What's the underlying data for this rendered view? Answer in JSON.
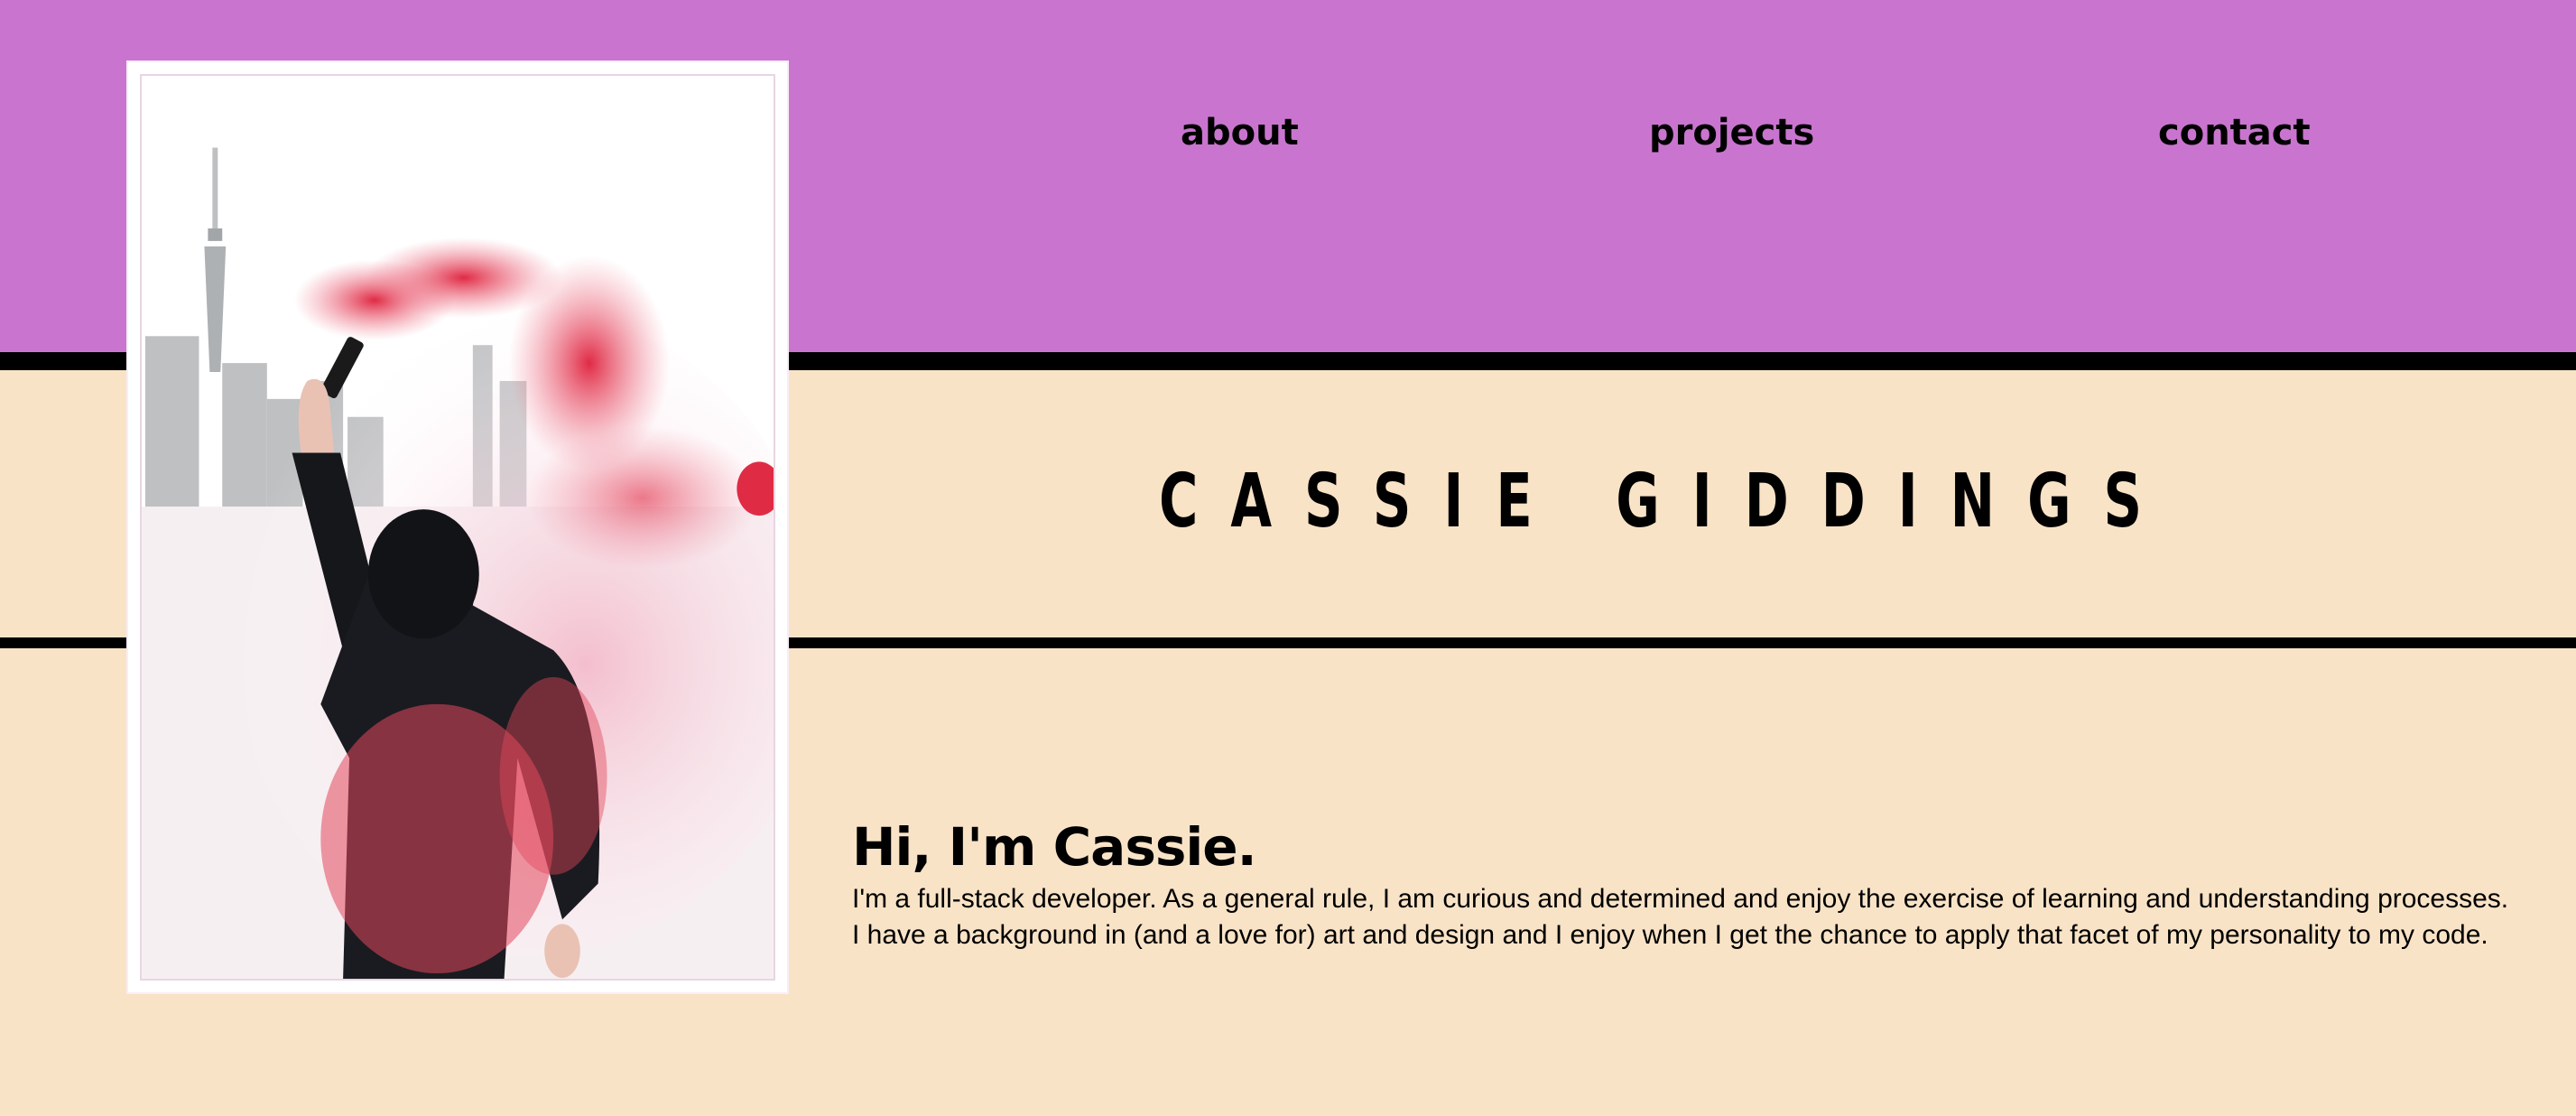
{
  "nav": {
    "about": "about",
    "projects": "projects",
    "contact": "contact"
  },
  "header": {
    "title": "CASSIE GIDDINGS"
  },
  "photo": {
    "alt": "Person in a black hoodie holding a red smoke flare in front of a city skyline"
  },
  "intro": {
    "greeting": "Hi, I'm Cassie.",
    "line1": "I'm a full-stack developer. As a general rule, I am curious and determined and enjoy the exercise of learning and understanding processes.",
    "line2": "I have a background in (and a love for) art and design and I enjoy when I get the chance to apply that facet of my personality to my code."
  },
  "colors": {
    "header_bg": "#c975cf",
    "page_bg": "#f9e3c7",
    "rule": "#000000",
    "smoke": "#e8465d"
  }
}
